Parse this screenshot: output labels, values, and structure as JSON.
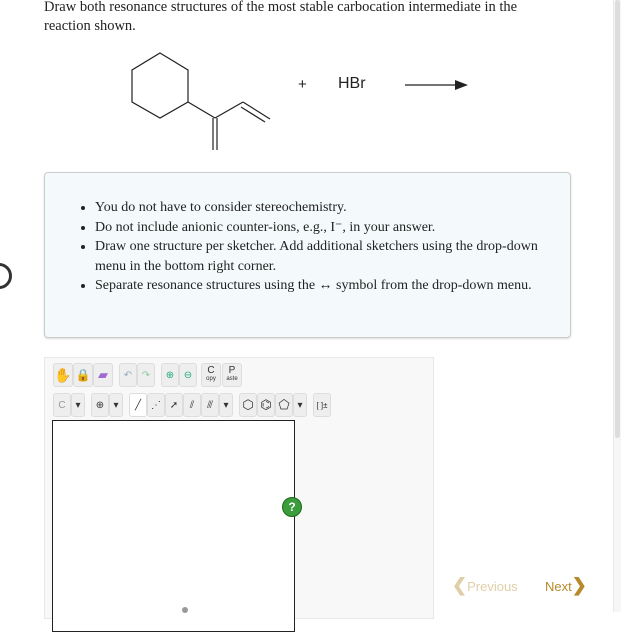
{
  "question": "Draw both resonance structures of the most stable carbocation intermediate in the reaction shown.",
  "reaction": {
    "plus": "+",
    "reagent": "HBr"
  },
  "instructions": [
    "You do not have to consider stereochemistry.",
    "Do not include anionic counter-ions, e.g., I⁻, in your answer.",
    "Draw one structure per sketcher. Add additional sketchers using the drop-down menu in the bottom right corner.",
    "Separate resonance structures using the ↔ symbol from the drop-down menu."
  ],
  "toolbar": {
    "copy_label": "C",
    "copy_sub": "opy",
    "paste_label": "P",
    "paste_sub": "aste",
    "atom_label": "C",
    "bracket_label": "[ ]±",
    "help_label": "?"
  },
  "nav": {
    "previous": "Previous",
    "next": "Next"
  }
}
